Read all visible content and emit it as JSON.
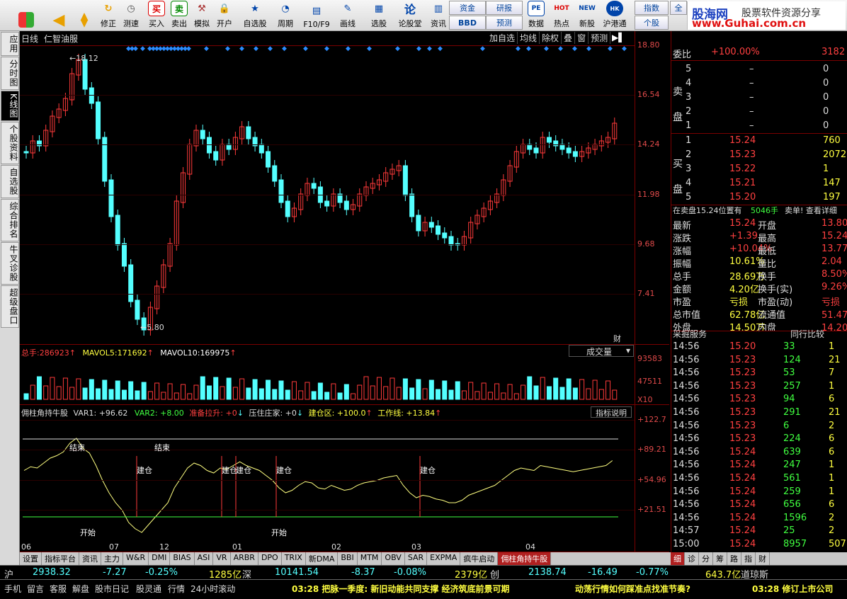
{
  "toolbar": {
    "buttons": [
      "修正",
      "测速",
      "买入",
      "卖出",
      "模拟",
      "开户",
      "自选股",
      "周期",
      "F10/F9",
      "画线",
      "选股",
      "论股堂",
      "资讯",
      "数据",
      "热点",
      "新股",
      "沪港通"
    ],
    "right_buttons": {
      "zijin": "资金",
      "yanbao": "研报",
      "bbd": "BBD",
      "yuce": "预测",
      "zhishu": "指数",
      "gegu": "个股",
      "quan": "全"
    },
    "logo": {
      "brand": "股海网",
      "tagline": "股票软件资源分享",
      "url": "www.Guhai.com.cn"
    }
  },
  "sidebar": [
    "应用",
    "分时图",
    "K线图",
    "个股资料",
    "自选股",
    "综合排名",
    "牛叉诊股",
    "超级盘口"
  ],
  "chart": {
    "period": "日线",
    "stock": "仁智油服",
    "buttons": [
      "加自选",
      "均线",
      "除权",
      "叠",
      "窗",
      "预测"
    ],
    "price_ticks": [
      "18.80",
      "16.54",
      "14.24",
      "11.98",
      "9.68",
      "7.41"
    ],
    "high_label": "18.12",
    "low_label": "5.80",
    "cai": "财",
    "vol": {
      "label": "总手:",
      "value": "286923",
      "ma5_label": "MAVOL5:",
      "ma5": "171692",
      "ma10_label": "MAVOL10:",
      "ma10": "169975",
      "ticks": [
        "93583",
        "47511",
        "X10"
      ],
      "dropdown": "成交量"
    },
    "ind": {
      "name": "佣柱角持牛股",
      "var1": "VAR1: +96.62",
      "var2": "VAR2: +8.00",
      "zbls": "准备拉升: +0",
      "yzzj": "压住庄家: +0",
      "jcq": "建仓区: +100.0",
      "gzx": "工作线: +13.84",
      "help": "指标说明",
      "ticks": [
        "+122.7",
        "+89.21",
        "+54.96",
        "+21.51"
      ],
      "tags": [
        "建仓",
        "建仓",
        "建仓",
        "建仓",
        "建仓",
        "结束",
        "结束",
        "开始",
        "开始"
      ]
    },
    "dates": [
      "06",
      "07",
      "12",
      "01",
      "02",
      "03",
      "04"
    ]
  },
  "bottom_tabs": [
    "设置",
    "指标平台",
    "资讯",
    "主力",
    "W&R",
    "DMI",
    "BIAS",
    "ASI",
    "VR",
    "ARBR",
    "DPO",
    "TRIX",
    "新DMA",
    "BBI",
    "MTM",
    "OBV",
    "SAR",
    "EXPMA",
    "疯牛启动",
    "佣柱角持牛股"
  ],
  "quote": {
    "title": "委比",
    "weibi": "+100.00%",
    "weicha": "3182",
    "sell_label": "卖盘",
    "buy_label": "买盘",
    "sells": [
      {
        "n": "5",
        "p": "–",
        "v": "0"
      },
      {
        "n": "4",
        "p": "–",
        "v": "0"
      },
      {
        "n": "3",
        "p": "–",
        "v": "0"
      },
      {
        "n": "2",
        "p": "–",
        "v": "0"
      },
      {
        "n": "1",
        "p": "–",
        "v": "0"
      }
    ],
    "buys": [
      {
        "n": "1",
        "p": "15.24",
        "v": "760"
      },
      {
        "n": "2",
        "p": "15.23",
        "v": "2072"
      },
      {
        "n": "3",
        "p": "15.22",
        "v": "1"
      },
      {
        "n": "4",
        "p": "15.21",
        "v": "147"
      },
      {
        "n": "5",
        "p": "15.20",
        "v": "197"
      }
    ],
    "note": "在卖盘15.24位置有",
    "note_v": "5046手",
    "note_r": "卖单! 查看详细",
    "stats": [
      [
        "最新",
        "15.24",
        "开盘",
        "13.80"
      ],
      [
        "涨跌",
        "+1.39",
        "最高",
        "15.24"
      ],
      [
        "涨幅",
        "+10.04%",
        "最低",
        "13.77"
      ],
      [
        "振幅",
        "10.61%",
        "量比",
        "2.04"
      ],
      [
        "总手",
        "28.69万",
        "换手",
        "8.50%"
      ],
      [
        "金额",
        "4.20亿",
        "换手(实)",
        "9.26%"
      ],
      [
        "市盈",
        "亏损",
        "市盈(动)",
        "亏损"
      ],
      [
        "总市值",
        "62.78亿",
        "流通值",
        "51.47亿"
      ],
      [
        "外盘",
        "14.50万",
        "内盘",
        "14.20万"
      ]
    ],
    "svc": "采掘服务",
    "cmp": "同行比较",
    "ticks": [
      [
        "14:56",
        "15.20",
        "33",
        "1"
      ],
      [
        "14:56",
        "15.23",
        "124",
        "21"
      ],
      [
        "14:56",
        "15.23",
        "53",
        "7"
      ],
      [
        "14:56",
        "15.23",
        "257",
        "1"
      ],
      [
        "14:56",
        "15.23",
        "94",
        "6"
      ],
      [
        "14:56",
        "15.23",
        "291",
        "21"
      ],
      [
        "14:56",
        "15.23",
        "6",
        "2"
      ],
      [
        "14:56",
        "15.23",
        "224",
        "6"
      ],
      [
        "14:56",
        "15.24",
        "639",
        "6"
      ],
      [
        "14:56",
        "15.24",
        "247",
        "1"
      ],
      [
        "14:56",
        "15.24",
        "561",
        "1"
      ],
      [
        "14:56",
        "15.24",
        "259",
        "1"
      ],
      [
        "14:56",
        "15.24",
        "656",
        "6"
      ],
      [
        "14:56",
        "15.24",
        "1596",
        "2"
      ],
      [
        "14:57",
        "15.24",
        "25",
        "2"
      ],
      [
        "15:00",
        "15.24",
        "8957",
        "507"
      ]
    ],
    "tabs": [
      "细",
      "诊",
      "分",
      "筹",
      "路",
      "指",
      "财"
    ]
  },
  "index": {
    "sh": "沪",
    "sh_v": "2938.32",
    "sh_c": "-7.27",
    "sh_p": "-0.25%",
    "sh_a": "1285亿",
    "sz": "深",
    "sz_v": "10141.54",
    "sz_c": "-8.37",
    "sz_p": "-0.08%",
    "sz_a": "2379亿",
    "cy": "创",
    "cy_v": "2138.74",
    "cy_c": "-16.49",
    "cy_p": "-0.77%",
    "amt": "643.7亿",
    "dj": "道琼斯"
  },
  "status": {
    "items": [
      "手机",
      "留言",
      "客服",
      "解盘",
      "股市日记",
      "股灵通",
      "行情",
      "24小时滚动"
    ],
    "news1": "03:28 把脉一季度: 新旧动能共同支撑 经济筑底前景可期",
    "news2": "动荡行情如何踩准点找准节奏?",
    "news3": "03:28 修订上市公司"
  },
  "colors": {
    "up": "#ff3a3a",
    "down": "#54ffff",
    "yellow": "#ffff3a"
  }
}
